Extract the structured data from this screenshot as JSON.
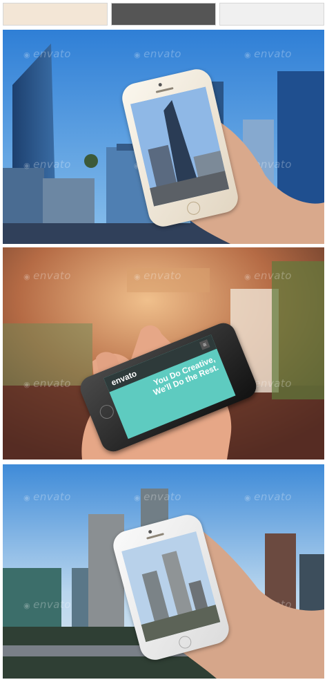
{
  "palette": {
    "swatches": [
      "#f3e6d6",
      "#555555",
      "#f0f0f0"
    ]
  },
  "watermark": "envato",
  "screen_app": {
    "logo": "envato",
    "headline_1": "You Do Creative,",
    "headline_2": "We'll Do the Rest."
  }
}
